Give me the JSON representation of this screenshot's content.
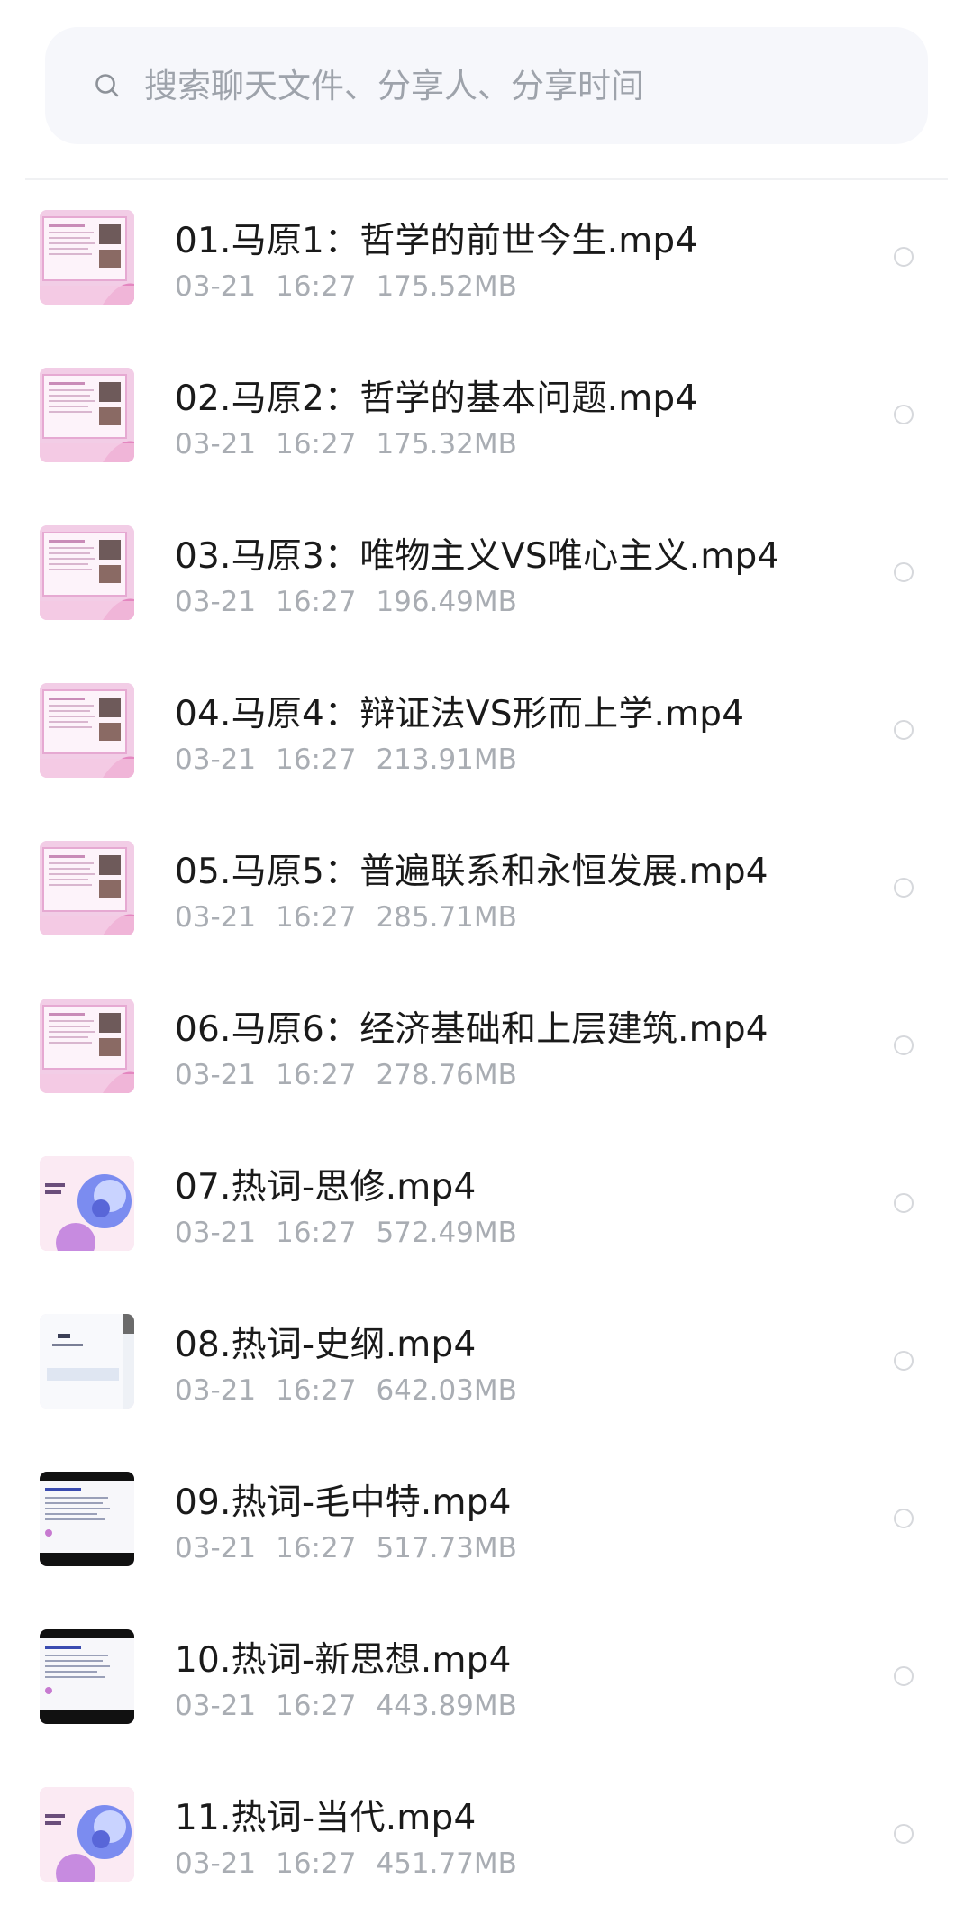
{
  "search": {
    "placeholder": "搜索聊天文件、分享人、分享时间"
  },
  "files": [
    {
      "name": "01.马原1：哲学的前世今生.mp4",
      "date": "03-21",
      "time": "16:27",
      "size": "175.52MB",
      "thumb": "slides-pink"
    },
    {
      "name": "02.马原2：哲学的基本问题.mp4",
      "date": "03-21",
      "time": "16:27",
      "size": "175.32MB",
      "thumb": "slides-pink"
    },
    {
      "name": "03.马原3：唯物主义VS唯心主义.mp4",
      "date": "03-21",
      "time": "16:27",
      "size": "196.49MB",
      "thumb": "slides-pink"
    },
    {
      "name": "04.马原4：辩证法VS形而上学.mp4",
      "date": "03-21",
      "time": "16:27",
      "size": "213.91MB",
      "thumb": "slides-pink"
    },
    {
      "name": "05.马原5：普遍联系和永恒发展.mp4",
      "date": "03-21",
      "time": "16:27",
      "size": "285.71MB",
      "thumb": "slides-pink"
    },
    {
      "name": "06.马原6：经济基础和上层建筑.mp4",
      "date": "03-21",
      "time": "16:27",
      "size": "278.76MB",
      "thumb": "slides-pink"
    },
    {
      "name": "07.热词-思修.mp4",
      "date": "03-21",
      "time": "16:27",
      "size": "572.49MB",
      "thumb": "cover-purple"
    },
    {
      "name": "08.热词-史纲.mp4",
      "date": "03-21",
      "time": "16:27",
      "size": "642.03MB",
      "thumb": "slides-white"
    },
    {
      "name": "09.热词-毛中特.mp4",
      "date": "03-21",
      "time": "16:27",
      "size": "517.73MB",
      "thumb": "slides-dark"
    },
    {
      "name": "10.热词-新思想.mp4",
      "date": "03-21",
      "time": "16:27",
      "size": "443.89MB",
      "thumb": "slides-dark"
    },
    {
      "name": "11.热词-当代.mp4",
      "date": "03-21",
      "time": "16:27",
      "size": "451.77MB",
      "thumb": "cover-purple"
    }
  ]
}
